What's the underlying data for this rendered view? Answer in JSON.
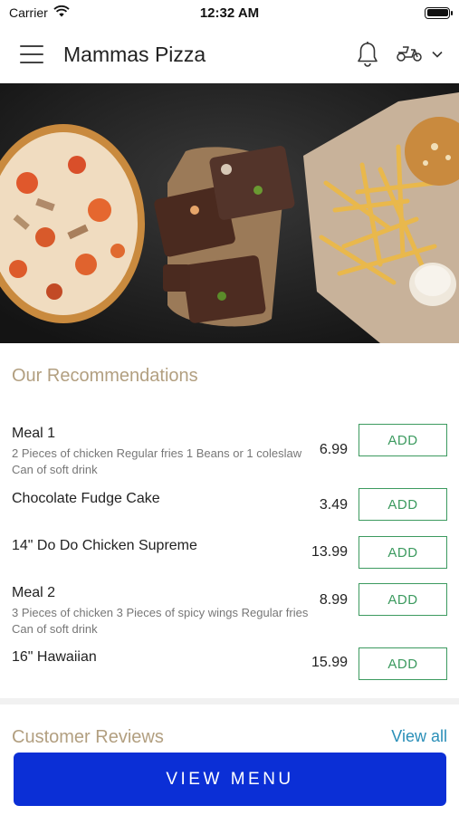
{
  "status_bar": {
    "carrier": "Carrier",
    "time": "12:32 AM"
  },
  "header": {
    "title": "Mammas Pizza"
  },
  "icons": {
    "menu": "hamburger-menu-icon",
    "notifications": "bell-icon",
    "delivery": "scooter-icon",
    "dropdown": "chevron-down-icon"
  },
  "recommendations": {
    "title": "Our Recommendations",
    "items": [
      {
        "name": "Meal 1",
        "description": "2 Pieces of chicken  Regular fries  1 Beans or 1 coleslaw  Can of soft drink",
        "price": "6.99",
        "button": "ADD"
      },
      {
        "name": "Chocolate Fudge Cake",
        "description": "",
        "price": "3.49",
        "button": "ADD"
      },
      {
        "name": "14\" Do Do Chicken Supreme",
        "description": "",
        "price": "13.99",
        "button": "ADD"
      },
      {
        "name": "Meal 2",
        "description": "3 Pieces of chicken  3 Pieces of spicy wings  Regular fries  Can of soft drink",
        "price": "8.99",
        "button": "ADD"
      },
      {
        "name": "16\" Hawaiian",
        "description": "",
        "price": "15.99",
        "button": "ADD"
      }
    ]
  },
  "reviews": {
    "title": "Customer Reviews",
    "view_all": "View all"
  },
  "cta": {
    "label": "VIEW MENU"
  },
  "colors": {
    "accent_green": "#3c9a5f",
    "section_title": "#b29f80",
    "link": "#2a8fb8",
    "primary_button": "#0b2fd6"
  }
}
